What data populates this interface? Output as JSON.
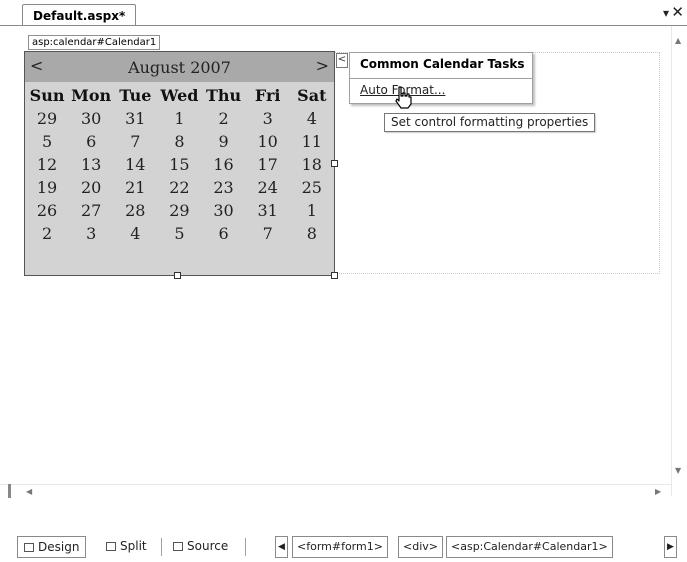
{
  "tab": {
    "title": "Default.aspx*",
    "dropdown_glyph": "▾",
    "close_glyph": "✕"
  },
  "control_tag": "asp:calendar#Calendar1",
  "calendar": {
    "prev": "<",
    "next": ">",
    "month_title": "August 2007",
    "day_headers": [
      "Sun",
      "Mon",
      "Tue",
      "Wed",
      "Thu",
      "Fri",
      "Sat"
    ],
    "weeks": [
      [
        "29",
        "30",
        "31",
        "1",
        "2",
        "3",
        "4"
      ],
      [
        "5",
        "6",
        "7",
        "8",
        "9",
        "10",
        "11"
      ],
      [
        "12",
        "13",
        "14",
        "15",
        "16",
        "17",
        "18"
      ],
      [
        "19",
        "20",
        "21",
        "22",
        "23",
        "24",
        "25"
      ],
      [
        "26",
        "27",
        "28",
        "29",
        "30",
        "31",
        "1"
      ],
      [
        "2",
        "3",
        "4",
        "5",
        "6",
        "7",
        "8"
      ]
    ]
  },
  "smart_tag": {
    "button_glyph": "<",
    "title": "Common Calendar Tasks",
    "link": "Auto Format...",
    "tooltip": "Set control formatting properties"
  },
  "bottom_bar": {
    "design": "Design",
    "split": "Split",
    "source": "Source",
    "crumbs": [
      "<form#form1>",
      "<div>",
      "<asp:Calendar#Calendar1>"
    ],
    "left_arrow": "◀",
    "right_arrow": "▶"
  },
  "colors": {
    "calendar_bg": "#d3d3d3",
    "calendar_title_bg": "#a9a9a9",
    "border": "#8a8a8a"
  }
}
